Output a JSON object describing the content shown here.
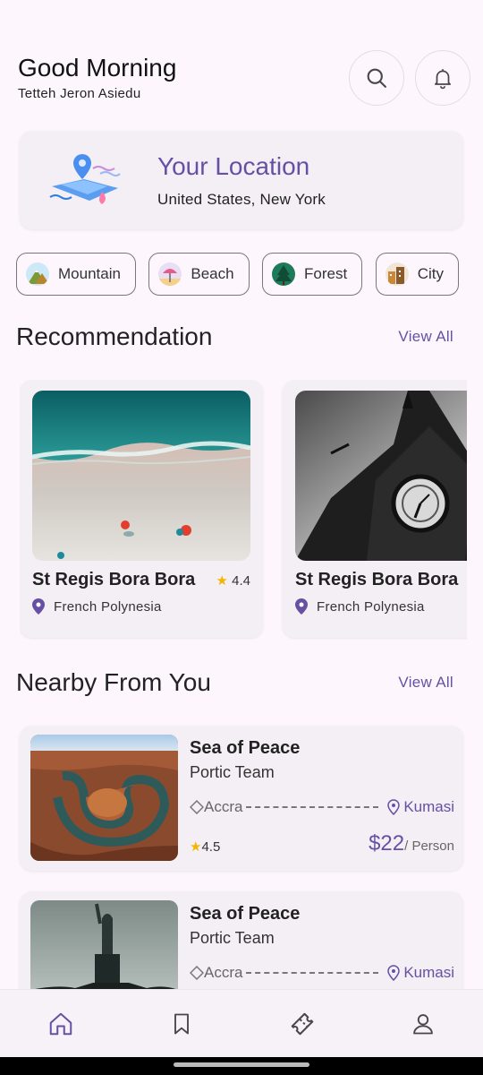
{
  "header": {
    "greeting": "Good Morning",
    "username": "Tetteh Jeron Asiedu",
    "search_icon": "search-icon",
    "notifications_icon": "bell-icon"
  },
  "location": {
    "title": "Your Location",
    "value": "United States, New York",
    "icon": "map-pin-illustration"
  },
  "categories": [
    {
      "label": "Mountain",
      "icon": "mountain-icon"
    },
    {
      "label": "Beach",
      "icon": "beach-icon"
    },
    {
      "label": "Forest",
      "icon": "forest-icon"
    },
    {
      "label": "City",
      "icon": "city-icon"
    }
  ],
  "recommendation": {
    "title": "Recommendation",
    "view_all": "View All",
    "items": [
      {
        "name": "St Regis Bora Bora",
        "rating": "4.4",
        "location": "French Polynesia",
        "image": "aerial beach"
      },
      {
        "name": "St Regis Bora Bora",
        "rating": "",
        "location": "French Polynesia",
        "image": "big ben clock tower"
      }
    ]
  },
  "nearby": {
    "title": "Nearby From You",
    "view_all": "View All",
    "items": [
      {
        "name": "Sea of Peace",
        "team": "Portic Team",
        "from": "Accra",
        "to": "Kumasi",
        "rating": "4.5",
        "price": "$22",
        "per": "/ Person",
        "image": "canyon river bend"
      },
      {
        "name": "Sea of Peace",
        "team": "Portic Team",
        "from": "Accra",
        "to": "Kumasi",
        "image": "statue of liberty"
      }
    ]
  },
  "nav": [
    {
      "name": "home",
      "icon": "home-icon"
    },
    {
      "name": "saved",
      "icon": "bookmark-icon"
    },
    {
      "name": "tickets",
      "icon": "ticket-icon"
    },
    {
      "name": "profile",
      "icon": "profile-icon"
    }
  ],
  "colors": {
    "accent": "#6750a4",
    "background": "#fdf7fd",
    "card": "#f4eff4",
    "star": "#f4b400"
  }
}
